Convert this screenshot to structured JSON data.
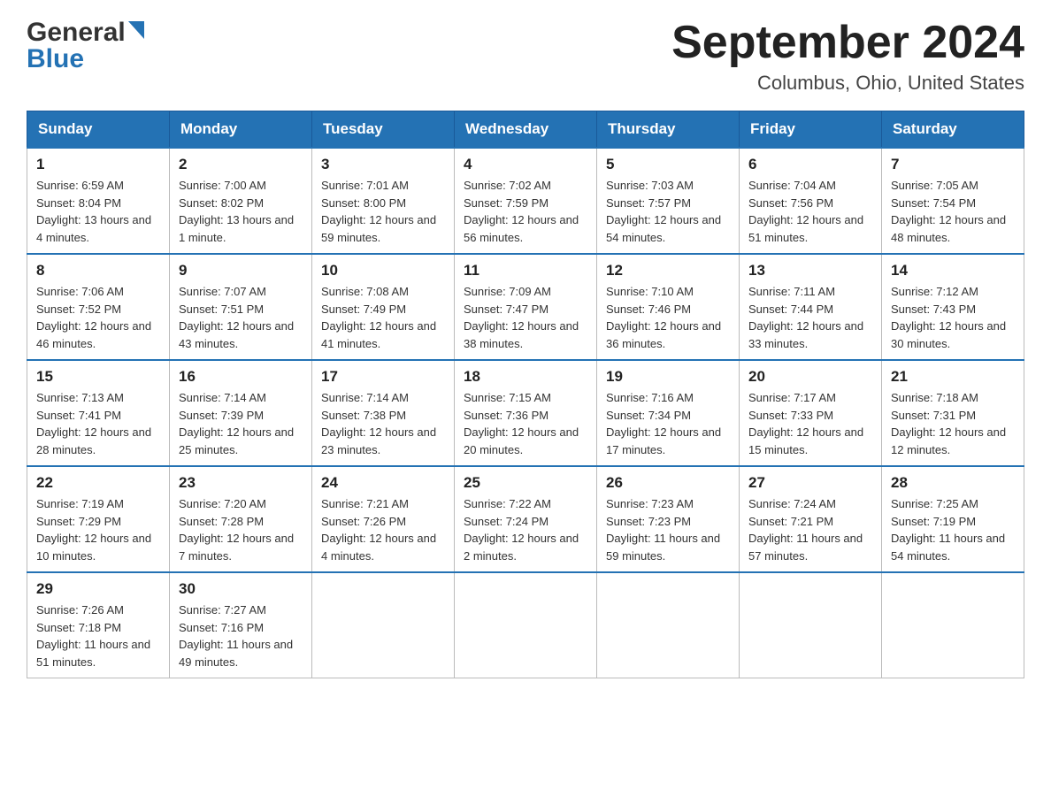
{
  "header": {
    "logo_general": "General",
    "logo_blue": "Blue",
    "month_title": "September 2024",
    "location": "Columbus, Ohio, United States"
  },
  "days_of_week": [
    "Sunday",
    "Monday",
    "Tuesday",
    "Wednesday",
    "Thursday",
    "Friday",
    "Saturday"
  ],
  "weeks": [
    [
      {
        "day": "1",
        "sunrise": "6:59 AM",
        "sunset": "8:04 PM",
        "daylight": "13 hours and 4 minutes."
      },
      {
        "day": "2",
        "sunrise": "7:00 AM",
        "sunset": "8:02 PM",
        "daylight": "13 hours and 1 minute."
      },
      {
        "day": "3",
        "sunrise": "7:01 AM",
        "sunset": "8:00 PM",
        "daylight": "12 hours and 59 minutes."
      },
      {
        "day": "4",
        "sunrise": "7:02 AM",
        "sunset": "7:59 PM",
        "daylight": "12 hours and 56 minutes."
      },
      {
        "day": "5",
        "sunrise": "7:03 AM",
        "sunset": "7:57 PM",
        "daylight": "12 hours and 54 minutes."
      },
      {
        "day": "6",
        "sunrise": "7:04 AM",
        "sunset": "7:56 PM",
        "daylight": "12 hours and 51 minutes."
      },
      {
        "day": "7",
        "sunrise": "7:05 AM",
        "sunset": "7:54 PM",
        "daylight": "12 hours and 48 minutes."
      }
    ],
    [
      {
        "day": "8",
        "sunrise": "7:06 AM",
        "sunset": "7:52 PM",
        "daylight": "12 hours and 46 minutes."
      },
      {
        "day": "9",
        "sunrise": "7:07 AM",
        "sunset": "7:51 PM",
        "daylight": "12 hours and 43 minutes."
      },
      {
        "day": "10",
        "sunrise": "7:08 AM",
        "sunset": "7:49 PM",
        "daylight": "12 hours and 41 minutes."
      },
      {
        "day": "11",
        "sunrise": "7:09 AM",
        "sunset": "7:47 PM",
        "daylight": "12 hours and 38 minutes."
      },
      {
        "day": "12",
        "sunrise": "7:10 AM",
        "sunset": "7:46 PM",
        "daylight": "12 hours and 36 minutes."
      },
      {
        "day": "13",
        "sunrise": "7:11 AM",
        "sunset": "7:44 PM",
        "daylight": "12 hours and 33 minutes."
      },
      {
        "day": "14",
        "sunrise": "7:12 AM",
        "sunset": "7:43 PM",
        "daylight": "12 hours and 30 minutes."
      }
    ],
    [
      {
        "day": "15",
        "sunrise": "7:13 AM",
        "sunset": "7:41 PM",
        "daylight": "12 hours and 28 minutes."
      },
      {
        "day": "16",
        "sunrise": "7:14 AM",
        "sunset": "7:39 PM",
        "daylight": "12 hours and 25 minutes."
      },
      {
        "day": "17",
        "sunrise": "7:14 AM",
        "sunset": "7:38 PM",
        "daylight": "12 hours and 23 minutes."
      },
      {
        "day": "18",
        "sunrise": "7:15 AM",
        "sunset": "7:36 PM",
        "daylight": "12 hours and 20 minutes."
      },
      {
        "day": "19",
        "sunrise": "7:16 AM",
        "sunset": "7:34 PM",
        "daylight": "12 hours and 17 minutes."
      },
      {
        "day": "20",
        "sunrise": "7:17 AM",
        "sunset": "7:33 PM",
        "daylight": "12 hours and 15 minutes."
      },
      {
        "day": "21",
        "sunrise": "7:18 AM",
        "sunset": "7:31 PM",
        "daylight": "12 hours and 12 minutes."
      }
    ],
    [
      {
        "day": "22",
        "sunrise": "7:19 AM",
        "sunset": "7:29 PM",
        "daylight": "12 hours and 10 minutes."
      },
      {
        "day": "23",
        "sunrise": "7:20 AM",
        "sunset": "7:28 PM",
        "daylight": "12 hours and 7 minutes."
      },
      {
        "day": "24",
        "sunrise": "7:21 AM",
        "sunset": "7:26 PM",
        "daylight": "12 hours and 4 minutes."
      },
      {
        "day": "25",
        "sunrise": "7:22 AM",
        "sunset": "7:24 PM",
        "daylight": "12 hours and 2 minutes."
      },
      {
        "day": "26",
        "sunrise": "7:23 AM",
        "sunset": "7:23 PM",
        "daylight": "11 hours and 59 minutes."
      },
      {
        "day": "27",
        "sunrise": "7:24 AM",
        "sunset": "7:21 PM",
        "daylight": "11 hours and 57 minutes."
      },
      {
        "day": "28",
        "sunrise": "7:25 AM",
        "sunset": "7:19 PM",
        "daylight": "11 hours and 54 minutes."
      }
    ],
    [
      {
        "day": "29",
        "sunrise": "7:26 AM",
        "sunset": "7:18 PM",
        "daylight": "11 hours and 51 minutes."
      },
      {
        "day": "30",
        "sunrise": "7:27 AM",
        "sunset": "7:16 PM",
        "daylight": "11 hours and 49 minutes."
      },
      null,
      null,
      null,
      null,
      null
    ]
  ],
  "labels": {
    "sunrise_prefix": "Sunrise: ",
    "sunset_prefix": "Sunset: ",
    "daylight_prefix": "Daylight: "
  }
}
